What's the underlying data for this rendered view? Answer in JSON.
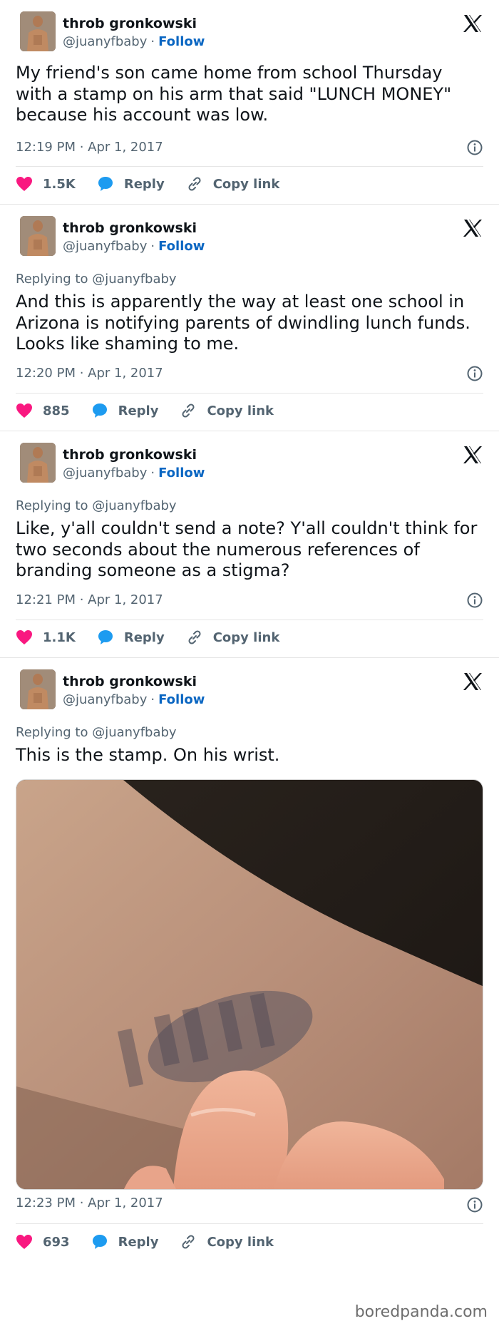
{
  "tweets": [
    {
      "author": {
        "name": "throb gronkowski",
        "handle": "@juanyfbaby",
        "follow_label": "Follow"
      },
      "replying_to": "",
      "text": "My friend's son came home from school Thursday with a stamp on his arm that said \"LUNCH MONEY\" because his account was low.",
      "timestamp": "12:19 PM · Apr 1, 2017",
      "likes": "1.5K",
      "reply_label": "Reply",
      "copy_link_label": "Copy link"
    },
    {
      "author": {
        "name": "throb gronkowski",
        "handle": "@juanyfbaby",
        "follow_label": "Follow"
      },
      "replying_to": "Replying to @juanyfbaby",
      "text": "And this is apparently the way at least one school in Arizona is notifying parents of dwindling lunch funds. Looks like shaming to me.",
      "timestamp": "12:20 PM · Apr 1, 2017",
      "likes": "885",
      "reply_label": "Reply",
      "copy_link_label": "Copy link"
    },
    {
      "author": {
        "name": "throb gronkowski",
        "handle": "@juanyfbaby",
        "follow_label": "Follow"
      },
      "replying_to": "Replying to @juanyfbaby",
      "text": "Like, y'all couldn't send a note? Y'all couldn't think for two seconds about the numerous references of branding someone as a stigma?",
      "timestamp": "12:21 PM · Apr 1, 2017",
      "likes": "1.1K",
      "reply_label": "Reply",
      "copy_link_label": "Copy link"
    },
    {
      "author": {
        "name": "throb gronkowski",
        "handle": "@juanyfbaby",
        "follow_label": "Follow"
      },
      "replying_to": "Replying to @juanyfbaby",
      "text": "This is the stamp. On his wrist.",
      "timestamp": "12:23 PM · Apr 1, 2017",
      "likes": "693",
      "reply_label": "Reply",
      "copy_link_label": "Copy link"
    }
  ],
  "watermark": "boredpanda.com",
  "colors": {
    "like": "#f91880",
    "reply": "#1d9bf0",
    "follow": "#0a66c2",
    "muted": "#536471"
  },
  "icons": {
    "brand": "x-logo-icon",
    "like": "heart-icon",
    "reply": "speech-bubble-icon",
    "copy": "chain-link-icon",
    "info": "info-icon"
  }
}
